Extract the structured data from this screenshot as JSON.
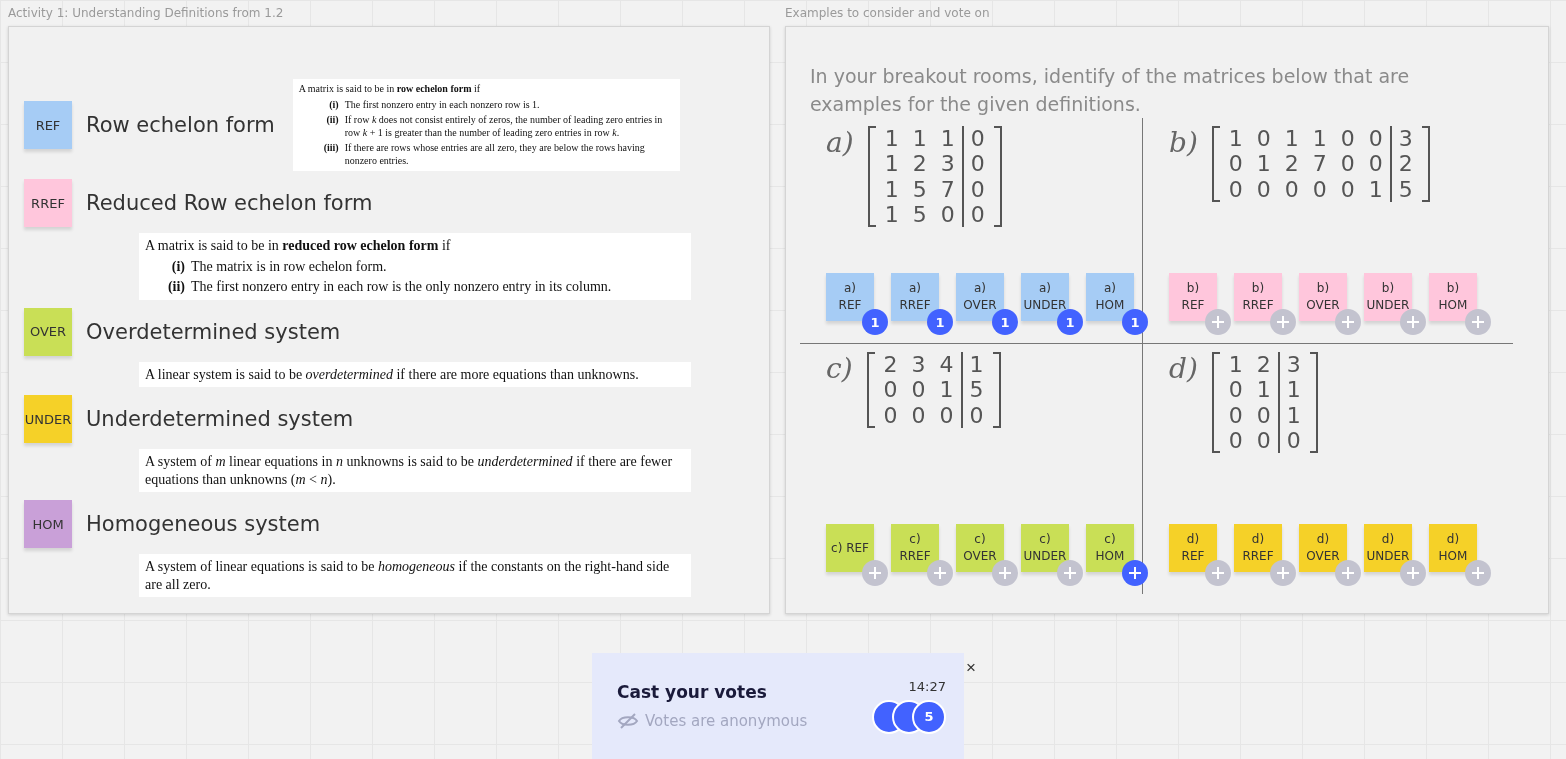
{
  "left_frame": {
    "title": "Activity 1: Understanding Definitions from 1.2",
    "definitions": [
      {
        "kind": "side",
        "tag": "REF",
        "color": "#a6ccf5",
        "title": "Row echelon form",
        "intro": "A matrix is said to be in **row echelon form** if",
        "items": [
          {
            "num": "(i)",
            "text": "The first nonzero entry in each nonzero row is 1."
          },
          {
            "num": "(ii)",
            "text": "If row *k* does not consist entirely of zeros, the number of leading zero entries in row *k* + 1 is greater than the number of leading zero entries in row *k*."
          },
          {
            "num": "(iii)",
            "text": "If there are rows whose entries are all zero, they are below the rows having nonzero entries."
          }
        ]
      },
      {
        "kind": "below",
        "tag": "RREF",
        "color": "#ffc6dc",
        "title": "Reduced Row echelon form",
        "intro": "A matrix is said to be in **reduced row echelon form** if",
        "items": [
          {
            "num": "(i)",
            "text": "The matrix is in row echelon form."
          },
          {
            "num": "(ii)",
            "text": "The first nonzero entry in each row is the only nonzero entry in its column."
          }
        ]
      },
      {
        "kind": "below",
        "tag": "OVER",
        "color": "#c9df56",
        "title": "Overdetermined system",
        "intro": "A linear system is said to be *overdetermined* if there are more equations than unknowns."
      },
      {
        "kind": "below",
        "tag": "UNDER",
        "color": "#f5d128",
        "title": "Underdetermined system",
        "intro": "A system of *m* linear equations in *n* unknowns is said to be *underdetermined* if there are fewer equations than unknowns (*m* < *n*)."
      },
      {
        "kind": "below",
        "tag": "HOM",
        "color": "#c9a0d8",
        "title": "Homogeneous system",
        "intro": "A system of linear equations is said to be *homogeneous* if the constants on the right-hand side are all zero."
      }
    ]
  },
  "right_frame": {
    "title": "Examples to consider and vote on",
    "prompt": "In your breakout rooms, identify of the matrices below that are examples for the given definitions.",
    "quadrants": [
      {
        "label": "a)",
        "color": "#a6ccf5",
        "rows": [
          [
            "1",
            "1",
            "1",
            "0"
          ],
          [
            "1",
            "2",
            "3",
            "0"
          ],
          [
            "1",
            "5",
            "7",
            "0"
          ],
          [
            "1",
            "5",
            "0",
            "0"
          ]
        ],
        "notes": [
          {
            "lines": [
              "a)",
              "REF"
            ],
            "badge": {
              "kind": "count",
              "text": "1"
            }
          },
          {
            "lines": [
              "a)",
              "RREF"
            ],
            "badge": {
              "kind": "count",
              "text": "1"
            }
          },
          {
            "lines": [
              "a)",
              "OVER"
            ],
            "badge": {
              "kind": "count",
              "text": "1"
            }
          },
          {
            "lines": [
              "a)",
              "UNDER"
            ],
            "badge": {
              "kind": "count",
              "text": "1"
            }
          },
          {
            "lines": [
              "a)",
              "HOM"
            ],
            "badge": {
              "kind": "count",
              "text": "1"
            }
          }
        ]
      },
      {
        "label": "b)",
        "color": "#ffc6dc",
        "rows": [
          [
            "1",
            "0",
            "1",
            "1",
            "0",
            "0",
            "3"
          ],
          [
            "0",
            "1",
            "2",
            "7",
            "0",
            "0",
            "2"
          ],
          [
            "0",
            "0",
            "0",
            "0",
            "0",
            "1",
            "5"
          ]
        ],
        "notes": [
          {
            "lines": [
              "b)",
              "REF"
            ],
            "badge": {
              "kind": "add",
              "active": false
            }
          },
          {
            "lines": [
              "b)",
              "RREF"
            ],
            "badge": {
              "kind": "add",
              "active": false
            }
          },
          {
            "lines": [
              "b)",
              "OVER"
            ],
            "badge": {
              "kind": "add",
              "active": false
            }
          },
          {
            "lines": [
              "b)",
              "UNDER"
            ],
            "badge": {
              "kind": "add",
              "active": false
            }
          },
          {
            "lines": [
              "b)",
              "HOM"
            ],
            "badge": {
              "kind": "add",
              "active": false
            }
          }
        ]
      },
      {
        "label": "c)",
        "color": "#c9df56",
        "rows": [
          [
            "2",
            "3",
            "4",
            "1"
          ],
          [
            "0",
            "0",
            "1",
            "5"
          ],
          [
            "0",
            "0",
            "0",
            "0"
          ]
        ],
        "notes": [
          {
            "lines": [
              "c) REF"
            ],
            "badge": {
              "kind": "add",
              "active": false
            }
          },
          {
            "lines": [
              "c)",
              "RREF"
            ],
            "badge": {
              "kind": "add",
              "active": false
            }
          },
          {
            "lines": [
              "c)",
              "OVER"
            ],
            "badge": {
              "kind": "add",
              "active": false
            }
          },
          {
            "lines": [
              "c)",
              "UNDER"
            ],
            "badge": {
              "kind": "add",
              "active": false
            }
          },
          {
            "lines": [
              "c)",
              "HOM"
            ],
            "badge": {
              "kind": "add",
              "active": true
            }
          }
        ]
      },
      {
        "label": "d)",
        "color": "#f5d128",
        "rows": [
          [
            "1",
            "2",
            "3"
          ],
          [
            "0",
            "1",
            "1"
          ],
          [
            "0",
            "0",
            "1"
          ],
          [
            "0",
            "0",
            "0"
          ]
        ],
        "notes": [
          {
            "lines": [
              "d)",
              "REF"
            ],
            "badge": {
              "kind": "add",
              "active": false
            }
          },
          {
            "lines": [
              "d)",
              "RREF"
            ],
            "badge": {
              "kind": "add",
              "active": false
            }
          },
          {
            "lines": [
              "d)",
              "OVER"
            ],
            "badge": {
              "kind": "add",
              "active": false
            }
          },
          {
            "lines": [
              "d)",
              "UNDER"
            ],
            "badge": {
              "kind": "add",
              "active": false
            }
          },
          {
            "lines": [
              "d)",
              "HOM"
            ],
            "badge": {
              "kind": "add",
              "active": false
            }
          }
        ]
      }
    ]
  },
  "voting": {
    "title": "Cast your votes",
    "subtitle": "Votes are anonymous",
    "timer": "14:27",
    "close": "×",
    "voters": "5"
  }
}
